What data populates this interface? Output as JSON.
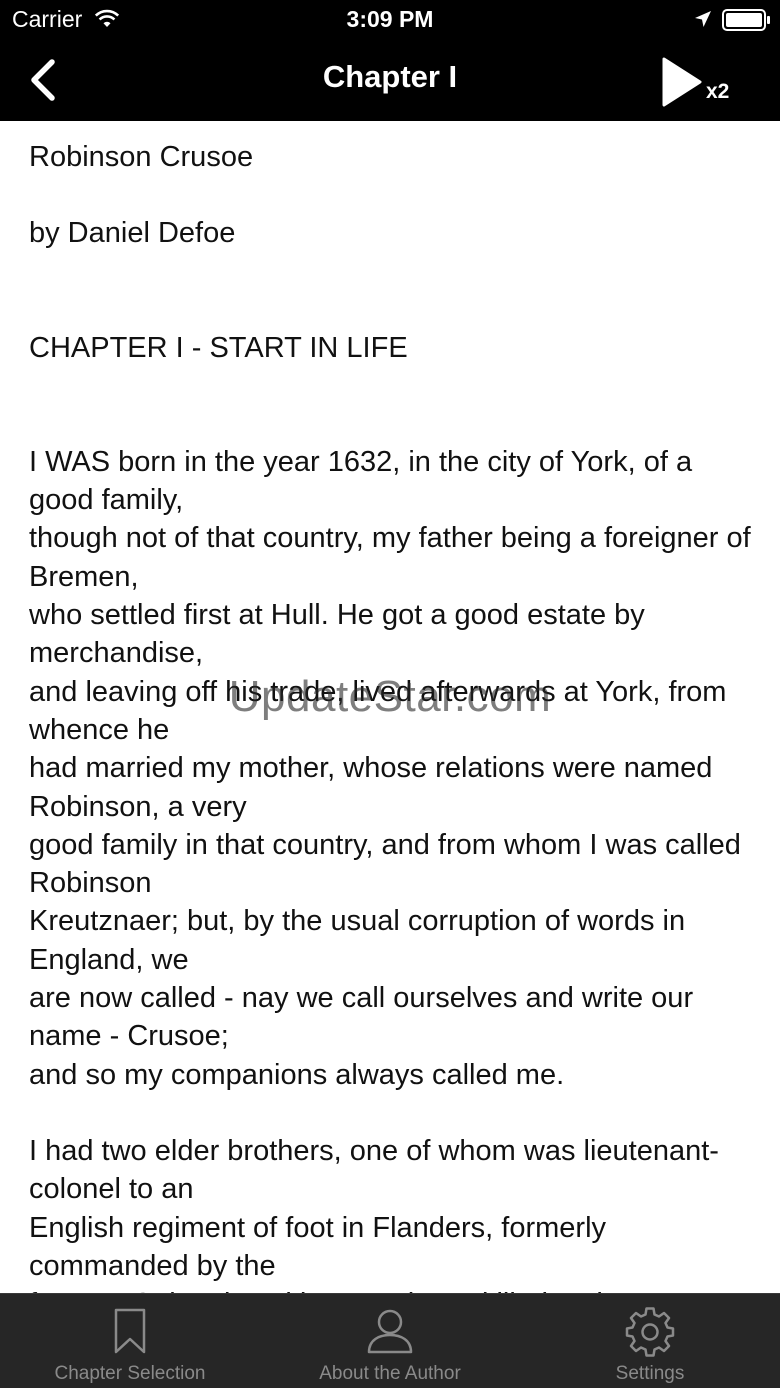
{
  "status_bar": {
    "carrier": "Carrier",
    "time": "3:09 PM",
    "icons": [
      "wifi-icon",
      "location-arrow-icon",
      "battery-icon"
    ]
  },
  "nav": {
    "title": "Chapter I",
    "back_icon": "chevron-left-icon",
    "play_icon": "play-icon",
    "speed": "x2"
  },
  "content": {
    "book_title": "Robinson Crusoe",
    "author": "by Daniel Defoe",
    "chapter_heading": "CHAPTER I - START IN LIFE",
    "paragraph_1": "I WAS born in the year 1632, in the city of York, of a good family,\nthough not of that country, my father being a foreigner of Bremen,\nwho settled first at Hull. He got a good estate by merchandise,\nand leaving off his trade, lived afterwards at York, from whence he\nhad married my mother, whose relations were named Robinson, a very\ngood family in that country, and from whom I was called Robinson\nKreutznaer; but, by the usual corruption of words in England, we\nare now called - nay we call ourselves and write our name - Crusoe;\nand so my companions always called me.",
    "paragraph_2": "I had two elder brothers, one of whom was lieutenant-colonel to an\nEnglish regiment of foot in Flanders, formerly commanded by the\nfamous Colonel Lockhart, and was killed at the"
  },
  "watermark": "UpdateStar.com",
  "tabbar": {
    "tabs": [
      {
        "label": "Chapter Selection",
        "icon": "bookmark-icon"
      },
      {
        "label": "About the Author",
        "icon": "person-icon"
      },
      {
        "label": "Settings",
        "icon": "gear-icon"
      }
    ],
    "colors": {
      "background": "#262626",
      "icon": "#8a8a8a"
    }
  },
  "colors": {
    "header": "#000000",
    "body_text": "#111111",
    "background": "#ffffff"
  }
}
